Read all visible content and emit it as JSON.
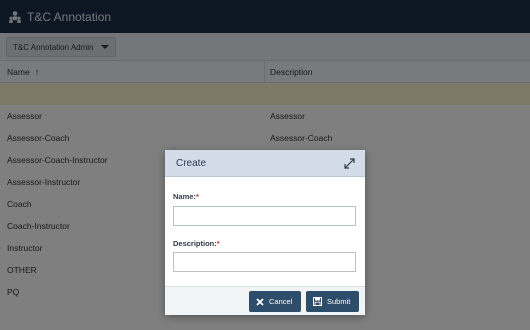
{
  "app": {
    "title": "T&C Annotation"
  },
  "toolbar": {
    "dropdown_label": "T&C Annotation Admin"
  },
  "table": {
    "columns": {
      "name": "Name",
      "description": "Description"
    },
    "rows": [
      {
        "name": "Assessor",
        "description": "Assessor"
      },
      {
        "name": "Assessor-Coach",
        "description": "Assessor-Coach"
      },
      {
        "name": "Assessor-Coach-Instructor",
        "description": ""
      },
      {
        "name": "Assessor-Instructor",
        "description": ""
      },
      {
        "name": "Coach",
        "description": ""
      },
      {
        "name": "Coach-Instructor",
        "description": ""
      },
      {
        "name": "Instructor",
        "description": ""
      },
      {
        "name": "OTHER",
        "description": ""
      },
      {
        "name": "PQ",
        "description": ""
      }
    ]
  },
  "modal": {
    "title": "Create",
    "name_label": "Name:",
    "description_label": "Description:",
    "required_mark": "*",
    "name_value": "",
    "description_value": "",
    "cancel_label": "Cancel",
    "submit_label": "Submit"
  },
  "icons": {
    "app": "users-icon",
    "sort": "sort-ascending-icon",
    "expand": "expand-icon",
    "cancel": "close-icon",
    "submit": "save-icon"
  },
  "colors": {
    "titlebar": "#1b2f46",
    "filter_row": "#fbf1cf",
    "modal_header": "#d3dbe8",
    "button": "#2d4d6b",
    "required": "#c0392b"
  }
}
